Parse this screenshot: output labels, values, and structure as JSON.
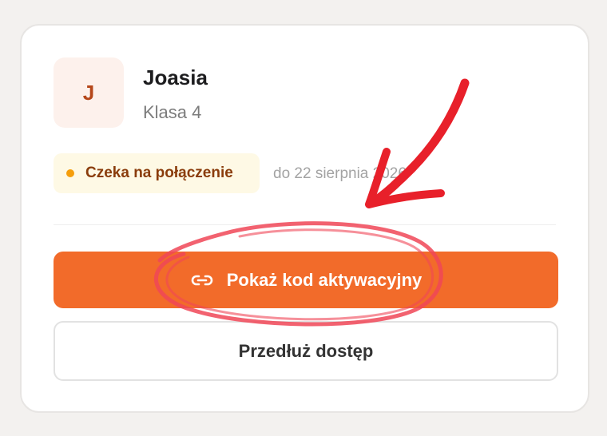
{
  "student": {
    "initial": "J",
    "name": "Joasia",
    "grade": "Klasa 4"
  },
  "status": {
    "label": "Czeka na połączenie",
    "date": "do 22 sierpnia 2026",
    "dot_color": "#f59e0b"
  },
  "actions": {
    "primary_label": "Pokaż kod aktywacyjny",
    "primary_icon": "link-icon",
    "secondary_label": "Przedłuż dostęp"
  },
  "colors": {
    "accent": "#f26b2a",
    "annotation": "#e8202a"
  }
}
